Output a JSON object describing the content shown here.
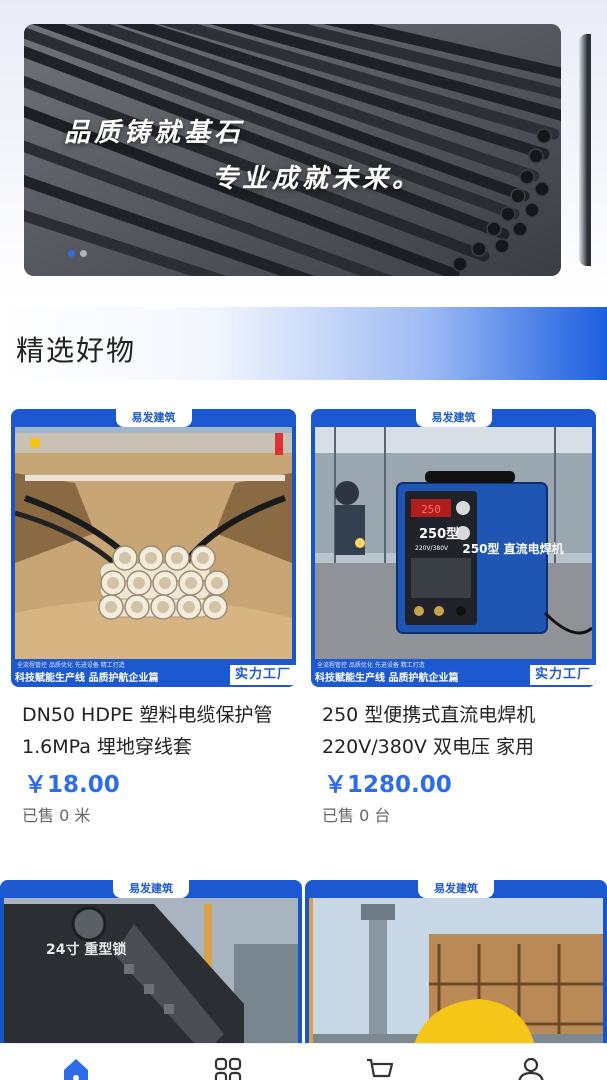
{
  "banner": {
    "line1": "品质铸就基石",
    "line2": "专业成就未来。",
    "slide_count": 2,
    "active_slide": 1
  },
  "section": {
    "title": "精选好物"
  },
  "products": [
    {
      "brand": "易发建筑",
      "caption_small": "全流程管控  品质优化  先进设备  精工打造",
      "caption_left": "科技赋能生产线 品质护航企业篇",
      "caption_right": "实力工厂",
      "title": "DN50 HDPE 塑料电缆保护管 1.6MPa 埋地穿线套",
      "price": "￥18.00",
      "sold": "已售 0 米"
    },
    {
      "brand": "易发建筑",
      "caption_small": "全流程管控  品质优化  先进设备  精工打造",
      "caption_left": "科技赋能生产线 品质护航企业篇",
      "caption_right": "实力工厂",
      "title": "250 型便携式直流电焊机 220V/380V 双电压 家用",
      "price": "￥1280.00",
      "sold": "已售 0 台"
    },
    {
      "brand": "易发建筑",
      "photo_label": "24寸 重型锁"
    },
    {
      "brand": "易发建筑"
    }
  ],
  "welder_labels": {
    "front": "250型",
    "panel": "220V/380V",
    "side": "250型 直流电焊机",
    "display": "250"
  },
  "tabbar": [
    {
      "name": "home",
      "icon": "home-icon",
      "active": true
    },
    {
      "name": "category",
      "icon": "grid-icon",
      "active": false
    },
    {
      "name": "cart",
      "icon": "cart-icon",
      "active": false
    },
    {
      "name": "profile",
      "icon": "user-icon",
      "active": false
    }
  ],
  "colors": {
    "accent": "#2f6de8",
    "brand_blue": "#1c58cf"
  }
}
